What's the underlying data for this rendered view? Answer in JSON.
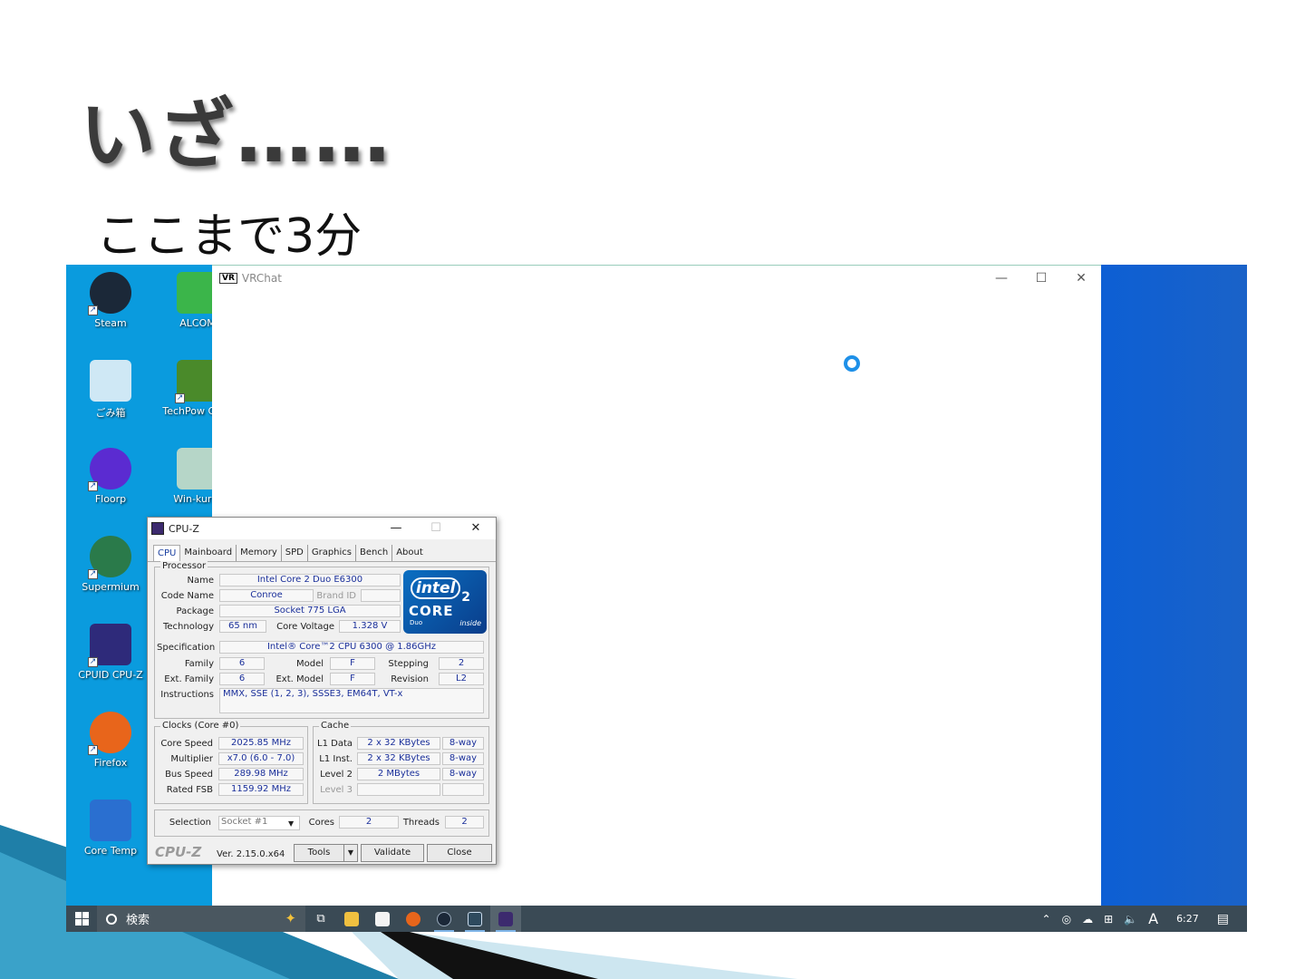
{
  "slide": {
    "title": "いざ……",
    "subtitle": "ここまで3分"
  },
  "desktop": {
    "icons": [
      {
        "label": "Steam",
        "icon": "steam-icon",
        "color": "#1b2838"
      },
      {
        "label": "ALCOM",
        "icon": "alcom-icon",
        "color": "#3bb54a"
      },
      {
        "label": "ごみ箱",
        "icon": "recycle-bin-icon",
        "color": "#cfe8f5"
      },
      {
        "label": "TechPow GPU-",
        "icon": "gpu-z-icon",
        "color": "#4a8a2a"
      },
      {
        "label": "Floorp",
        "icon": "floorp-icon",
        "color": "#5b2bd1"
      },
      {
        "label": "Win-kurar",
        "icon": "win-kurar-icon",
        "color": "#b6d6c8"
      },
      {
        "label": "Supermium",
        "icon": "supermium-icon",
        "color": "#2a7a4a"
      },
      {
        "label": "CPUID CPU-Z",
        "icon": "cpuz-icon",
        "color": "#2e2a7a"
      },
      {
        "label": "Firefox",
        "icon": "firefox-icon",
        "color": "#e8651b"
      },
      {
        "label": "Core Temp",
        "icon": "core-temp-icon",
        "color": "#2a6fd0"
      }
    ]
  },
  "vrchat": {
    "title": "VRChat",
    "logo": "VR",
    "minimize": "—",
    "maximize": "☐",
    "close": "✕"
  },
  "cpuz": {
    "title": "CPU-Z",
    "minimize": "—",
    "maximize": "☐",
    "close": "✕",
    "tabs": [
      "CPU",
      "Mainboard",
      "Memory",
      "SPD",
      "Graphics",
      "Bench",
      "About"
    ],
    "processor": {
      "group": "Processor",
      "name_label": "Name",
      "name": "Intel Core 2 Duo E6300",
      "codename_label": "Code Name",
      "codename": "Conroe",
      "brandid_label": "Brand ID",
      "brandid": "",
      "package_label": "Package",
      "package": "Socket 775 LGA",
      "technology_label": "Technology",
      "technology": "65 nm",
      "voltage_label": "Core Voltage",
      "voltage": "1.328 V",
      "spec_label": "Specification",
      "spec": "Intel® Core™2 CPU          6300  @ 1.86GHz",
      "family_label": "Family",
      "family": "6",
      "model_label": "Model",
      "model": "F",
      "stepping_label": "Stepping",
      "stepping": "2",
      "extfamily_label": "Ext. Family",
      "extfamily": "6",
      "extmodel_label": "Ext. Model",
      "extmodel": "F",
      "revision_label": "Revision",
      "revision": "L2",
      "instructions_label": "Instructions",
      "instructions": "MMX, SSE (1, 2, 3), SSSE3, EM64T, VT-x"
    },
    "intel_logo": {
      "brand": "intel",
      "core": "CORE",
      "two": "2",
      "duo": "Duo",
      "inside": "inside"
    },
    "clocks": {
      "group": "Clocks (Core #0)",
      "corespeed_label": "Core Speed",
      "corespeed": "2025.85 MHz",
      "multiplier_label": "Multiplier",
      "multiplier": "x7.0 (6.0 - 7.0)",
      "busspeed_label": "Bus Speed",
      "busspeed": "289.98 MHz",
      "ratedfsb_label": "Rated FSB",
      "ratedfsb": "1159.92 MHz"
    },
    "cache": {
      "group": "Cache",
      "l1data_label": "L1 Data",
      "l1data": "2 x 32 KBytes",
      "l1data_way": "8-way",
      "l1inst_label": "L1 Inst.",
      "l1inst": "2 x 32 KBytes",
      "l1inst_way": "8-way",
      "l2_label": "Level 2",
      "l2": "2 MBytes",
      "l2_way": "8-way",
      "l3_label": "Level 3",
      "l3": "",
      "l3_way": ""
    },
    "selection_label": "Selection",
    "selection": "Socket #1",
    "cores_label": "Cores",
    "cores": "2",
    "threads_label": "Threads",
    "threads": "2",
    "footer_logo": "CPU-Z",
    "version": "Ver. 2.15.0.x64",
    "tools": "Tools",
    "validate": "Validate",
    "close_btn": "Close"
  },
  "taskbar": {
    "search_placeholder": "検索",
    "clock": "6:27",
    "ime": "A"
  }
}
